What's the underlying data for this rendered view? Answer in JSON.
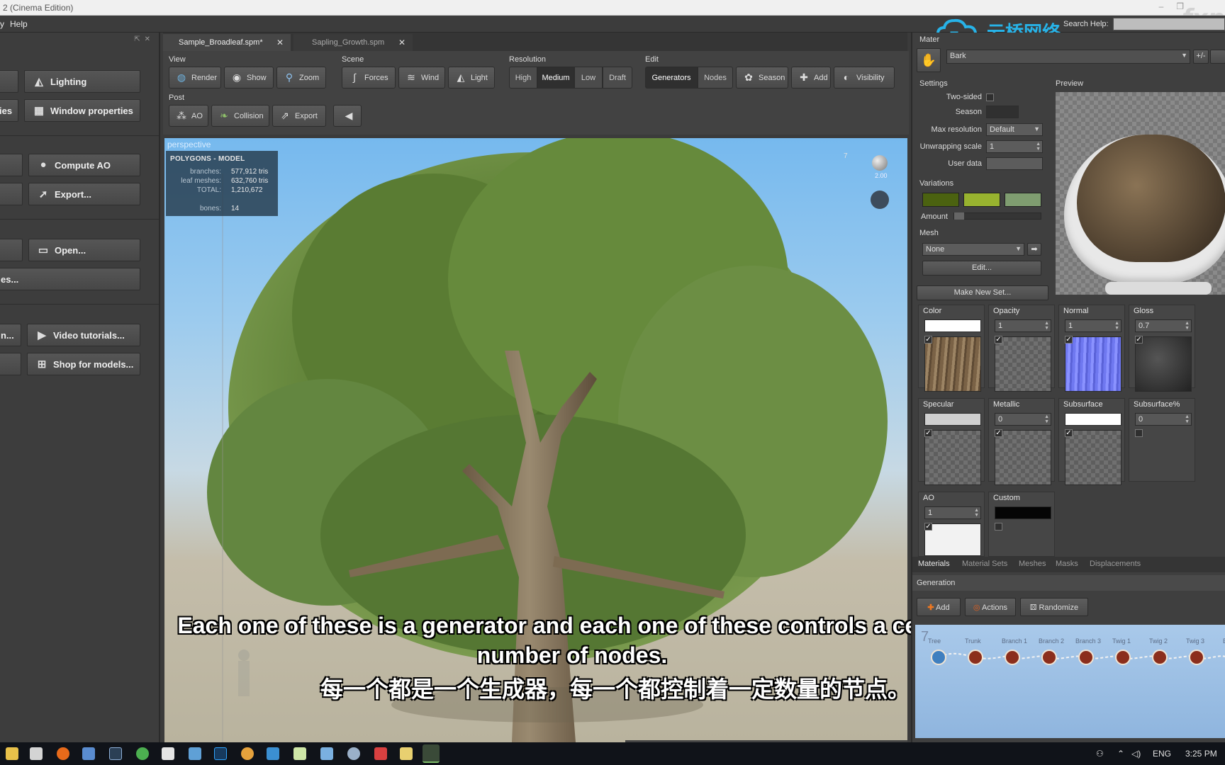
{
  "window": {
    "title": "2 (Cinema Edition)",
    "watermark": "fxp"
  },
  "menubar": {
    "items": [
      "y",
      "Help"
    ],
    "search_label": "Search Help:",
    "search_placeholder": ""
  },
  "brand": {
    "text": "云桥网络",
    "color": "#27b3e8"
  },
  "left_panel": {
    "buttons": {
      "lighting": "Lighting",
      "ies": "ies",
      "window_properties": "Window properties",
      "compute_ao": "Compute AO",
      "export": "Export...",
      "open": "Open...",
      "es": "es...",
      "n": "n...",
      "video_tutorials": "Video tutorials...",
      "shop_for_models": "Shop for models..."
    }
  },
  "tabs": [
    {
      "label": "Sample_Broadleaf.spm*",
      "active": true
    },
    {
      "label": "Sapling_Growth.spm",
      "active": false
    }
  ],
  "toolbar": {
    "groups": {
      "view": "View",
      "scene": "Scene",
      "resolution": "Resolution",
      "edit": "Edit",
      "post": "Post"
    },
    "view_buttons": {
      "render": "Render",
      "show": "Show",
      "zoom": "Zoom"
    },
    "scene_buttons": {
      "forces": "Forces",
      "wind": "Wind",
      "light": "Light"
    },
    "resolution_buttons": {
      "high": "High",
      "medium": "Medium",
      "low": "Low",
      "draft": "Draft",
      "selected": "Medium"
    },
    "edit_buttons": {
      "generators": "Generators",
      "nodes": "Nodes",
      "season": "Season",
      "add": "Add",
      "visibility": "Visibility"
    },
    "post_buttons": {
      "ao": "AO",
      "collision": "Collision",
      "export": "Export"
    }
  },
  "viewport": {
    "mode": "perspective",
    "stats": {
      "header": "POLYGONS - MODEL",
      "rows": [
        {
          "key": "branches:",
          "value": "577,912 tris"
        },
        {
          "key": "leaf meshes:",
          "value": "632,760 tris"
        },
        {
          "key": "TOTAL:",
          "value": "1,210,672"
        },
        {
          "key": "bones:",
          "value": "14"
        }
      ]
    },
    "gizmo_value": "2.00",
    "axis_tick": "7"
  },
  "subtitles": {
    "english": "Each one of these is a generator and each one of these controls a certain number of nodes.",
    "chinese": "每一个都是一个生成器，每一个都控制着一定数量的节点。"
  },
  "material_panel": {
    "header": "Mater",
    "material_name": "Bark",
    "plus_minus": "+/-",
    "settings_label": "Settings",
    "preview_label": "Preview",
    "two_sided_label": "Two-sided",
    "season_label": "Season",
    "max_resolution_label": "Max resolution",
    "max_resolution_value": "Default",
    "unwrapping_scale_label": "Unwrapping scale",
    "unwrapping_scale_value": "1",
    "user_data_label": "User data",
    "variations_label": "Variations",
    "variation_colors": [
      "#4b6210",
      "#98b32f",
      "#7f9d70"
    ],
    "amount_label": "Amount",
    "mesh_label": "Mesh",
    "mesh_value": "None",
    "edit_button": "Edit...",
    "make_new_set_button": "Make New Set...",
    "maps": [
      {
        "name": "Color",
        "value": "",
        "checked": true,
        "thumb": "bark"
      },
      {
        "name": "Opacity",
        "value": "1",
        "checked": true,
        "thumb": "checker"
      },
      {
        "name": "Normal",
        "value": "1",
        "checked": true,
        "thumb": "normal"
      },
      {
        "name": "Gloss",
        "value": "0.7",
        "checked": true,
        "thumb": "gloss"
      },
      {
        "name": "Specular",
        "value": "",
        "checked": true,
        "thumb": "checker"
      },
      {
        "name": "Metallic",
        "value": "0",
        "checked": true,
        "thumb": "checker"
      },
      {
        "name": "Subsurface",
        "value": "",
        "checked": true,
        "thumb": "checker"
      },
      {
        "name": "Subsurface%",
        "value": "0",
        "checked": false,
        "thumb": "none"
      },
      {
        "name": "AO",
        "value": "1",
        "checked": true,
        "thumb": "white"
      },
      {
        "name": "Custom",
        "value": "",
        "checked": false,
        "thumb": "none"
      }
    ],
    "bottom_tabs": [
      "Materials",
      "Material Sets",
      "Meshes",
      "Masks",
      "Displacements"
    ],
    "active_bottom_tab": "Materials"
  },
  "generation_panel": {
    "header": "Generation",
    "buttons": {
      "add": "Add",
      "actions": "Actions",
      "randomize": "Randomize"
    },
    "nodes": [
      "Tree",
      "Trunk",
      "Branch 1",
      "Branch 2",
      "Branch 3",
      "Twig 1",
      "Twig 2",
      "Twig 3",
      "Ba"
    ]
  },
  "taskbar": {
    "language": "ENG",
    "time": "3:25 PM"
  }
}
